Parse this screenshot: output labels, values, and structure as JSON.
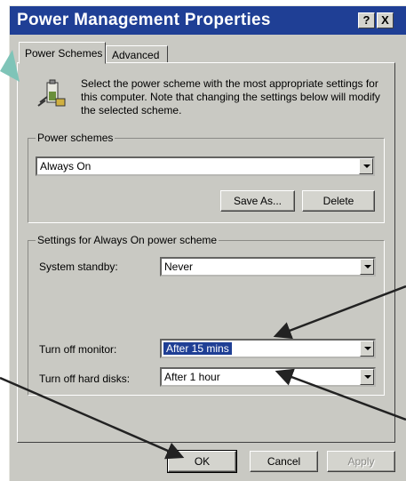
{
  "window": {
    "title": "Power Management Properties",
    "help_label": "?",
    "close_label": "X"
  },
  "tabs": [
    {
      "label": "Power Schemes"
    },
    {
      "label": "Advanced"
    }
  ],
  "intro": {
    "text": "Select the power scheme with the most appropriate settings for this computer. Note that changing the settings below will modify the selected scheme."
  },
  "power_schemes": {
    "group_label": "Power schemes",
    "selected": "Always On",
    "save_as_label": "Save As...",
    "delete_label": "Delete"
  },
  "settings": {
    "group_label": "Settings for Always On power scheme",
    "system_standby_label": "System standby:",
    "system_standby_value": "Never",
    "monitor_label": "Turn off monitor:",
    "monitor_value": "After 15 mins",
    "hard_disks_label": "Turn off hard disks:",
    "hard_disks_value": "After 1 hour"
  },
  "footer": {
    "ok_label": "OK",
    "cancel_label": "Cancel",
    "apply_label": "Apply"
  },
  "colors": {
    "titlebar": "#1f3f95",
    "dialog_face": "#c9c9c3",
    "selection": "#1f3f95"
  },
  "icons": {
    "scheme_icon": "battery-plug-icon"
  }
}
